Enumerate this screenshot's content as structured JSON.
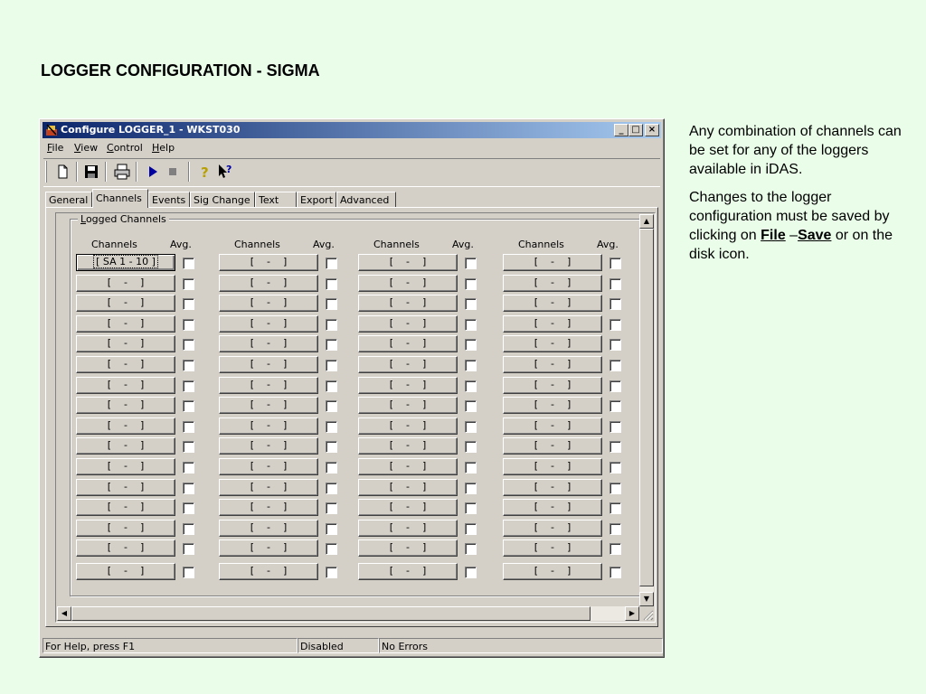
{
  "slide": {
    "title": "LOGGER CONFIGURATION - SIGMA",
    "para1": "Any combination of channels can be set for any of the loggers available in iDAS.",
    "para2_pre": "Changes to the logger configuration must be saved by clicking on ",
    "para2_file": "File",
    "para2_dash": " –",
    "para2_save": "Save",
    "para2_post": " or on the disk icon."
  },
  "window": {
    "title": "Configure LOGGER_1 - WKST030",
    "menu": [
      "File",
      "View",
      "Control",
      "Help"
    ],
    "toolbar_icons": [
      "new-file-icon",
      "save-disk-icon",
      "print-icon",
      "play-icon",
      "stop-icon",
      "help-icon",
      "context-help-icon"
    ]
  },
  "tabs": [
    {
      "label": "General",
      "active": false
    },
    {
      "label": "Channels",
      "active": true
    },
    {
      "label": "Events",
      "active": false
    },
    {
      "label": "Sig Change",
      "active": false
    },
    {
      "label": "Text",
      "active": false
    },
    {
      "label": "Export",
      "active": false
    },
    {
      "label": "Advanced",
      "active": false
    }
  ],
  "logged_channels": {
    "group_label": "Logged Channels",
    "channels_header": "Channels",
    "avg_header": "Avg.",
    "columns": 4,
    "rows": 16,
    "first_value": "[ SA 1 - 10 ]",
    "empty_value": "[    -    ]"
  },
  "statusbar": {
    "help": "For Help, press F1",
    "state": "Disabled",
    "errors": "No Errors"
  }
}
